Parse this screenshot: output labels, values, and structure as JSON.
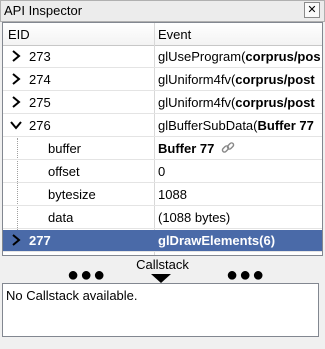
{
  "window": {
    "title": "API Inspector",
    "close_glyph": "✕"
  },
  "columns": {
    "eid": "EID",
    "event": "Event"
  },
  "rows": [
    {
      "eid": "273",
      "event_pre": "glUseProgram(",
      "event_bold": "corprus/pos",
      "expand": "›"
    },
    {
      "eid": "274",
      "event_pre": "glUniform4fv(",
      "event_bold": "corprus/post",
      "expand": "›"
    },
    {
      "eid": "275",
      "event_pre": "glUniform4fv(",
      "event_bold": "corprus/post",
      "expand": "›"
    },
    {
      "eid": "276",
      "event_pre": "glBufferSubData(",
      "event_bold": "Buffer 77",
      "expand": "∨"
    }
  ],
  "params": [
    {
      "name": "buffer",
      "value": "Buffer 77",
      "value_bold": true,
      "has_link_icon": true
    },
    {
      "name": "offset",
      "value": "0"
    },
    {
      "name": "bytesize",
      "value": "1088"
    },
    {
      "name": "data",
      "value": "(1088 bytes)"
    }
  ],
  "selected": {
    "eid": "277",
    "event": "glDrawElements(6)",
    "expand": "›"
  },
  "callstack": {
    "label": "Callstack",
    "dots": "●●●",
    "empty_text": "No Callstack available."
  },
  "icons": {
    "link": "chain-link-icon",
    "close": "close-icon",
    "expand": "chevron-right-icon",
    "collapse": "chevron-down-icon"
  },
  "colors": {
    "selection": "#4a6aa8"
  }
}
